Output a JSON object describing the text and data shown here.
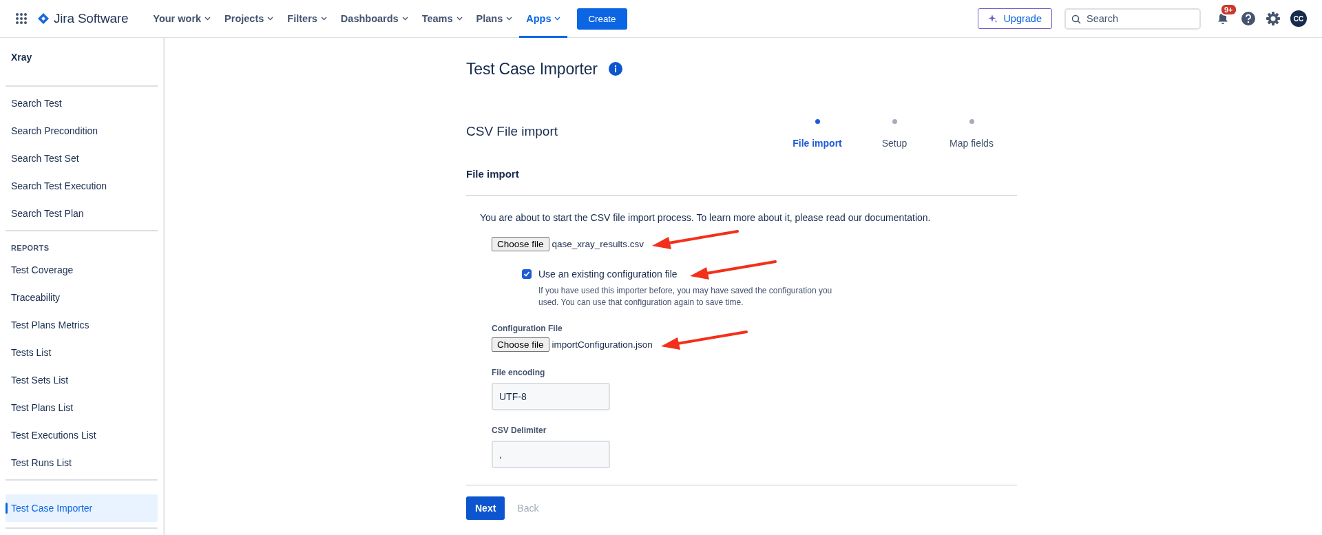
{
  "top_nav": {
    "product": "Jira Software",
    "items": [
      {
        "label": "Your work",
        "selected": false
      },
      {
        "label": "Projects",
        "selected": false
      },
      {
        "label": "Filters",
        "selected": false
      },
      {
        "label": "Dashboards",
        "selected": false
      },
      {
        "label": "Teams",
        "selected": false
      },
      {
        "label": "Plans",
        "selected": false
      },
      {
        "label": "Apps",
        "selected": true
      }
    ],
    "create_button": "Create",
    "upgrade_button": "Upgrade",
    "search": {
      "placeholder": "Search"
    },
    "notifications_badge": "9+",
    "avatar_initials": "CC"
  },
  "sidebar": {
    "title": "Xray",
    "sections": [
      {
        "items": [
          {
            "label": "Search Test",
            "selected": false
          },
          {
            "label": "Search Precondition",
            "selected": false
          },
          {
            "label": "Search Test Set",
            "selected": false
          },
          {
            "label": "Search Test Execution",
            "selected": false
          },
          {
            "label": "Search Test Plan",
            "selected": false
          }
        ]
      },
      {
        "heading": "REPORTS",
        "items": [
          {
            "label": "Test Coverage",
            "selected": false
          },
          {
            "label": "Traceability",
            "selected": false
          },
          {
            "label": "Test Plans Metrics",
            "selected": false
          },
          {
            "label": "Tests List",
            "selected": false
          },
          {
            "label": "Test Sets List",
            "selected": false
          },
          {
            "label": "Test Plans List",
            "selected": false
          },
          {
            "label": "Test Executions List",
            "selected": false
          },
          {
            "label": "Test Runs List",
            "selected": false
          }
        ]
      },
      {
        "items": [
          {
            "label": "Test Case Importer",
            "selected": true
          }
        ]
      }
    ]
  },
  "page": {
    "title": "Test Case Importer",
    "subtitle": "CSV File import",
    "steps": [
      {
        "label": "File import",
        "selected": true
      },
      {
        "label": "Setup",
        "selected": false
      },
      {
        "label": "Map fields",
        "selected": false
      }
    ],
    "section_title": "File import",
    "intro": "You are about to start the CSV file import process. To learn more about it, please read our documentation.",
    "file_input": {
      "button": "Choose file",
      "file_name": "qase_xray_results.csv",
      "arrow": true
    },
    "use_existing_config": {
      "label": "Use an existing configuration file",
      "checked": true,
      "help": "If you have used this importer before, you may have saved the configuration you used. You can use that configuration again to save time.",
      "arrow": true
    },
    "config_file": {
      "label": "Configuration File",
      "button": "Choose file",
      "file_name": "importConfiguration.json",
      "arrow": true
    },
    "file_encoding": {
      "label": "File encoding",
      "value": "UTF-8"
    },
    "csv_delimiter": {
      "label": "CSV Delimiter",
      "value": ","
    },
    "next_button": "Next",
    "back_button": {
      "label": "Back",
      "disabled": true
    }
  }
}
